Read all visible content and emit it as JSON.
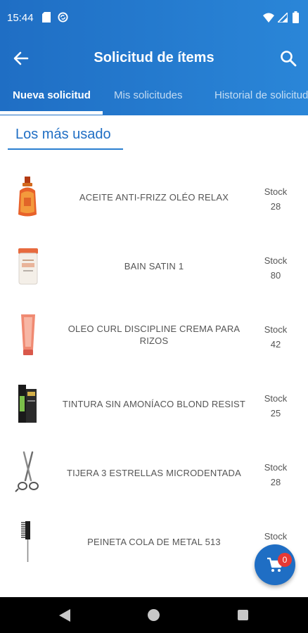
{
  "status_bar": {
    "time": "15:44"
  },
  "toolbar": {
    "title": "Solicitud de ítems",
    "back_icon": "arrow-back-icon",
    "search_icon": "search-icon"
  },
  "tabs": [
    {
      "label": "Nueva solicitud",
      "active": true
    },
    {
      "label": "Mis solicitudes",
      "active": false
    },
    {
      "label": "Historial de solicitudes",
      "active": false
    }
  ],
  "section": {
    "title": "Los más usado"
  },
  "items": [
    {
      "name": "ACEITE ANTI-FRIZZ OLÉO RELAX",
      "stock_label": "Stock",
      "stock": "28",
      "image": "oil-bottle-icon"
    },
    {
      "name": "BAIN SATIN 1",
      "stock_label": "Stock",
      "stock": "80",
      "image": "shampoo-bottle-icon"
    },
    {
      "name": "OLEO CURL DISCIPLINE CREMA PARA RIZOS",
      "stock_label": "Stock",
      "stock": "42",
      "image": "cream-tube-icon"
    },
    {
      "name": "TINTURA SIN AMONÍACO BLOND RESIST",
      "stock_label": "Stock",
      "stock": "25",
      "image": "hair-dye-box-icon"
    },
    {
      "name": "TIJERA 3 ESTRELLAS MICRODENTADA",
      "stock_label": "Stock",
      "stock": "28",
      "image": "scissors-icon"
    },
    {
      "name": "PEINETA COLA DE METAL 513",
      "stock_label": "Stock",
      "stock": "",
      "image": "comb-icon"
    }
  ],
  "cart": {
    "count": "0",
    "icon": "shopping-cart-icon"
  },
  "colors": {
    "primary": "#1f6ec4",
    "accent_gradient_end": "#2a86d8",
    "badge": "#e53935",
    "text": "#555555"
  }
}
